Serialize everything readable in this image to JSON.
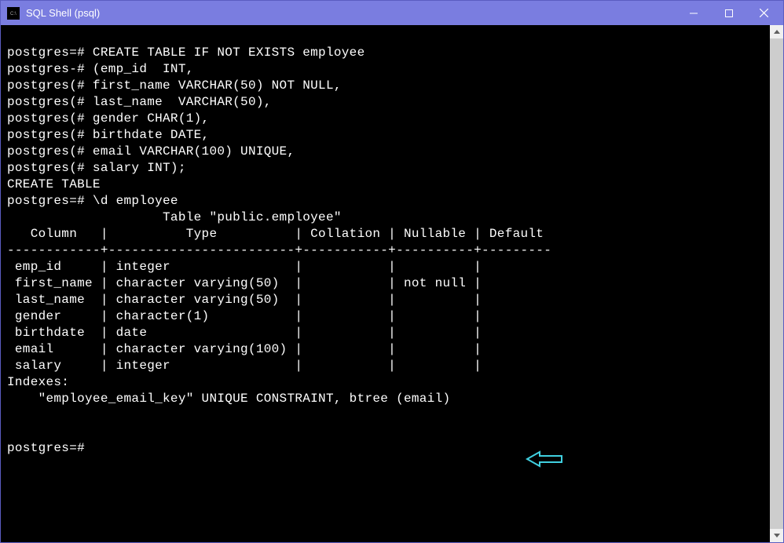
{
  "window": {
    "title": "SQL Shell (psql)"
  },
  "terminal": {
    "lines": [
      "postgres=# CREATE TABLE IF NOT EXISTS employee",
      "postgres-# (emp_id  INT,",
      "postgres(# first_name VARCHAR(50) NOT NULL,",
      "postgres(# last_name  VARCHAR(50),",
      "postgres(# gender CHAR(1),",
      "postgres(# birthdate DATE,",
      "postgres(# email VARCHAR(100) UNIQUE,",
      "postgres(# salary INT);",
      "CREATE TABLE",
      "postgres=# \\d employee",
      "                    Table \"public.employee\"",
      "   Column   |          Type          | Collation | Nullable | Default",
      "------------+------------------------+-----------+----------+---------",
      " emp_id     | integer                |           |          |",
      " first_name | character varying(50)  |           | not null |",
      " last_name  | character varying(50)  |           |          |",
      " gender     | character(1)           |           |          |",
      " birthdate  | date                   |           |          |",
      " email      | character varying(100) |           |          |",
      " salary     | integer                |           |          |",
      "Indexes:",
      "    \"employee_email_key\" UNIQUE CONSTRAINT, btree (email)",
      "",
      "",
      "postgres=#"
    ]
  },
  "table_schema": {
    "name": "public.employee",
    "columns": [
      {
        "column": "emp_id",
        "type": "integer",
        "collation": "",
        "nullable": "",
        "default": ""
      },
      {
        "column": "first_name",
        "type": "character varying(50)",
        "collation": "",
        "nullable": "not null",
        "default": ""
      },
      {
        "column": "last_name",
        "type": "character varying(50)",
        "collation": "",
        "nullable": "",
        "default": ""
      },
      {
        "column": "gender",
        "type": "character(1)",
        "collation": "",
        "nullable": "",
        "default": ""
      },
      {
        "column": "birthdate",
        "type": "date",
        "collation": "",
        "nullable": "",
        "default": ""
      },
      {
        "column": "email",
        "type": "character varying(100)",
        "collation": "",
        "nullable": "",
        "default": ""
      },
      {
        "column": "salary",
        "type": "integer",
        "collation": "",
        "nullable": "",
        "default": ""
      }
    ],
    "indexes": [
      {
        "name": "employee_email_key",
        "description": "UNIQUE CONSTRAINT, btree (email)"
      }
    ]
  }
}
